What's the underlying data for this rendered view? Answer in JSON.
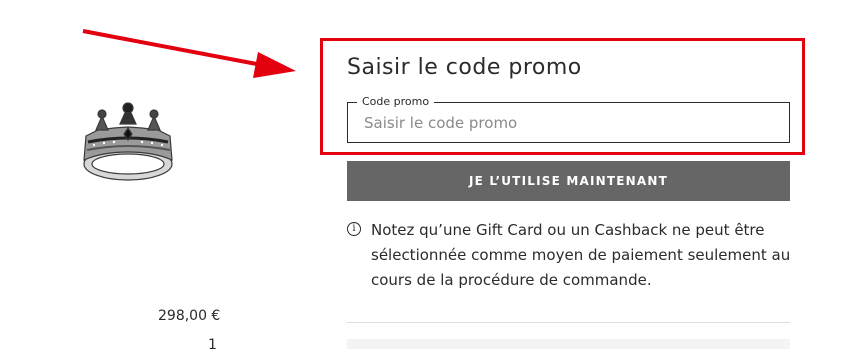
{
  "promo": {
    "title": "Saisir le code promo",
    "field_label": "Code promo",
    "placeholder": "Saisir le code promo",
    "value": ""
  },
  "apply_button_label": "JE L’UTILISE MAINTENANT",
  "notice": {
    "icon": "info-icon",
    "icon_glyph": "i",
    "text": "Notez qu’une Gift Card ou un Cashback ne peut être sélectionnée comme moyen de paiement seulement au cours de la procédure de commande."
  },
  "product": {
    "price": "298,00 €",
    "quantity": "1"
  },
  "colors": {
    "highlight": "#e3000f",
    "button": "#666666",
    "text": "#2b2b2b"
  }
}
